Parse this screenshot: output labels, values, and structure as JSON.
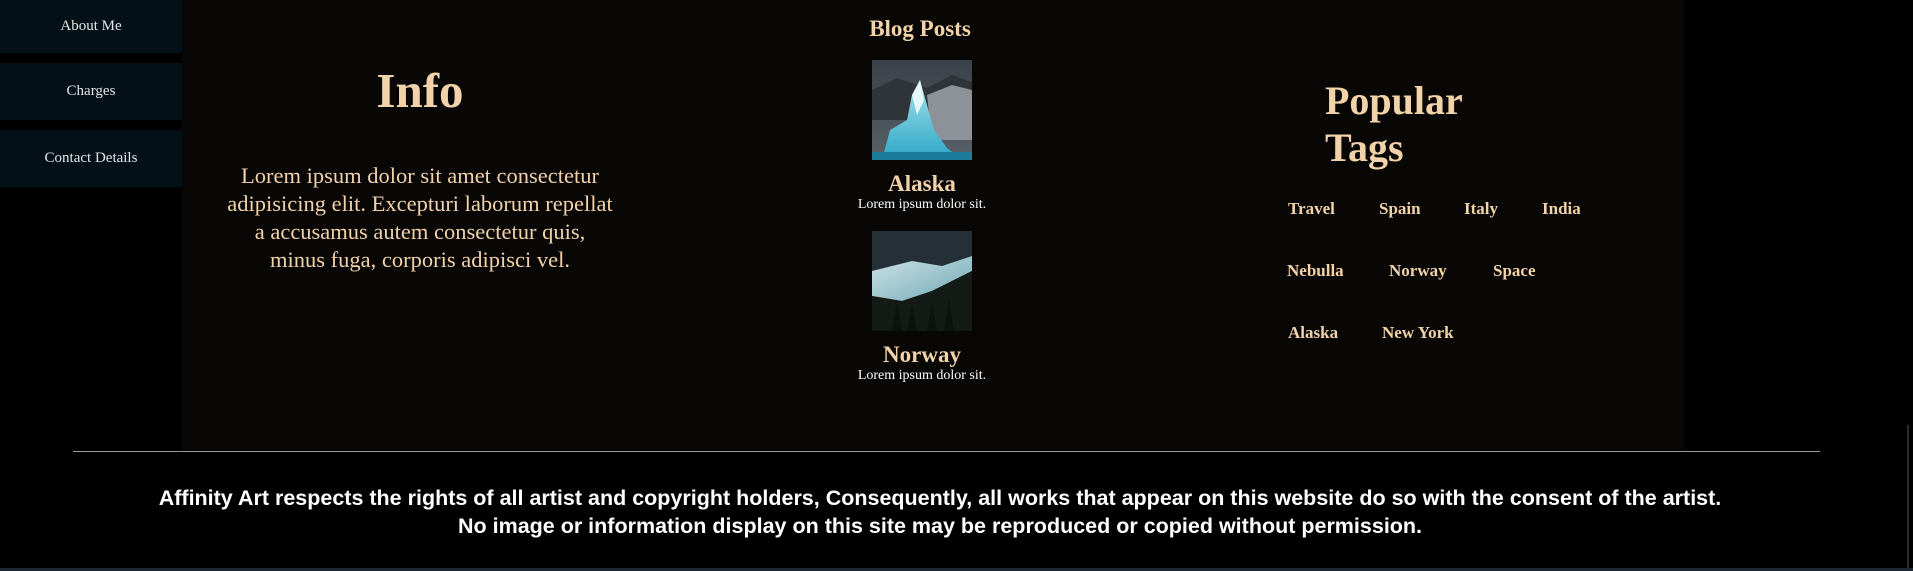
{
  "sidebar": {
    "items": [
      {
        "label": "About Me"
      },
      {
        "label": "Charges"
      },
      {
        "label": "Contact Details"
      }
    ]
  },
  "info": {
    "title": "Info",
    "text": "Lorem ipsum dolor sit amet consectetur adipisicing elit. Excepturi laborum repellat a accusamus autem consectetur quis, minus fuga, corporis adipisci vel."
  },
  "blog": {
    "title": "Blog Posts",
    "posts": [
      {
        "title": "Alaska",
        "desc": "Lorem ipsum dolor sit.",
        "image": "glacier-photo"
      },
      {
        "title": "Norway",
        "desc": "Lorem ipsum dolor sit.",
        "image": "lake-photo"
      }
    ]
  },
  "tags": {
    "title_line1": "Popular",
    "title_line2": "Tags",
    "items": [
      "Travel",
      "Spain",
      "Italy",
      "India",
      "Nebulla",
      "Norway",
      "Space",
      "Alaska",
      "New York"
    ]
  },
  "footer": {
    "line1": "Affinity Art respects the rights of all artist and copyright holders, Consequently, all works that appear on this website do so with the consent of the artist.",
    "line2": "No image or information display on this site may be reproduced or copied without permission."
  },
  "colors": {
    "accent": "#f2d2a9",
    "panel": "#080705",
    "sidebar": "#031018",
    "background": "#000000"
  }
}
